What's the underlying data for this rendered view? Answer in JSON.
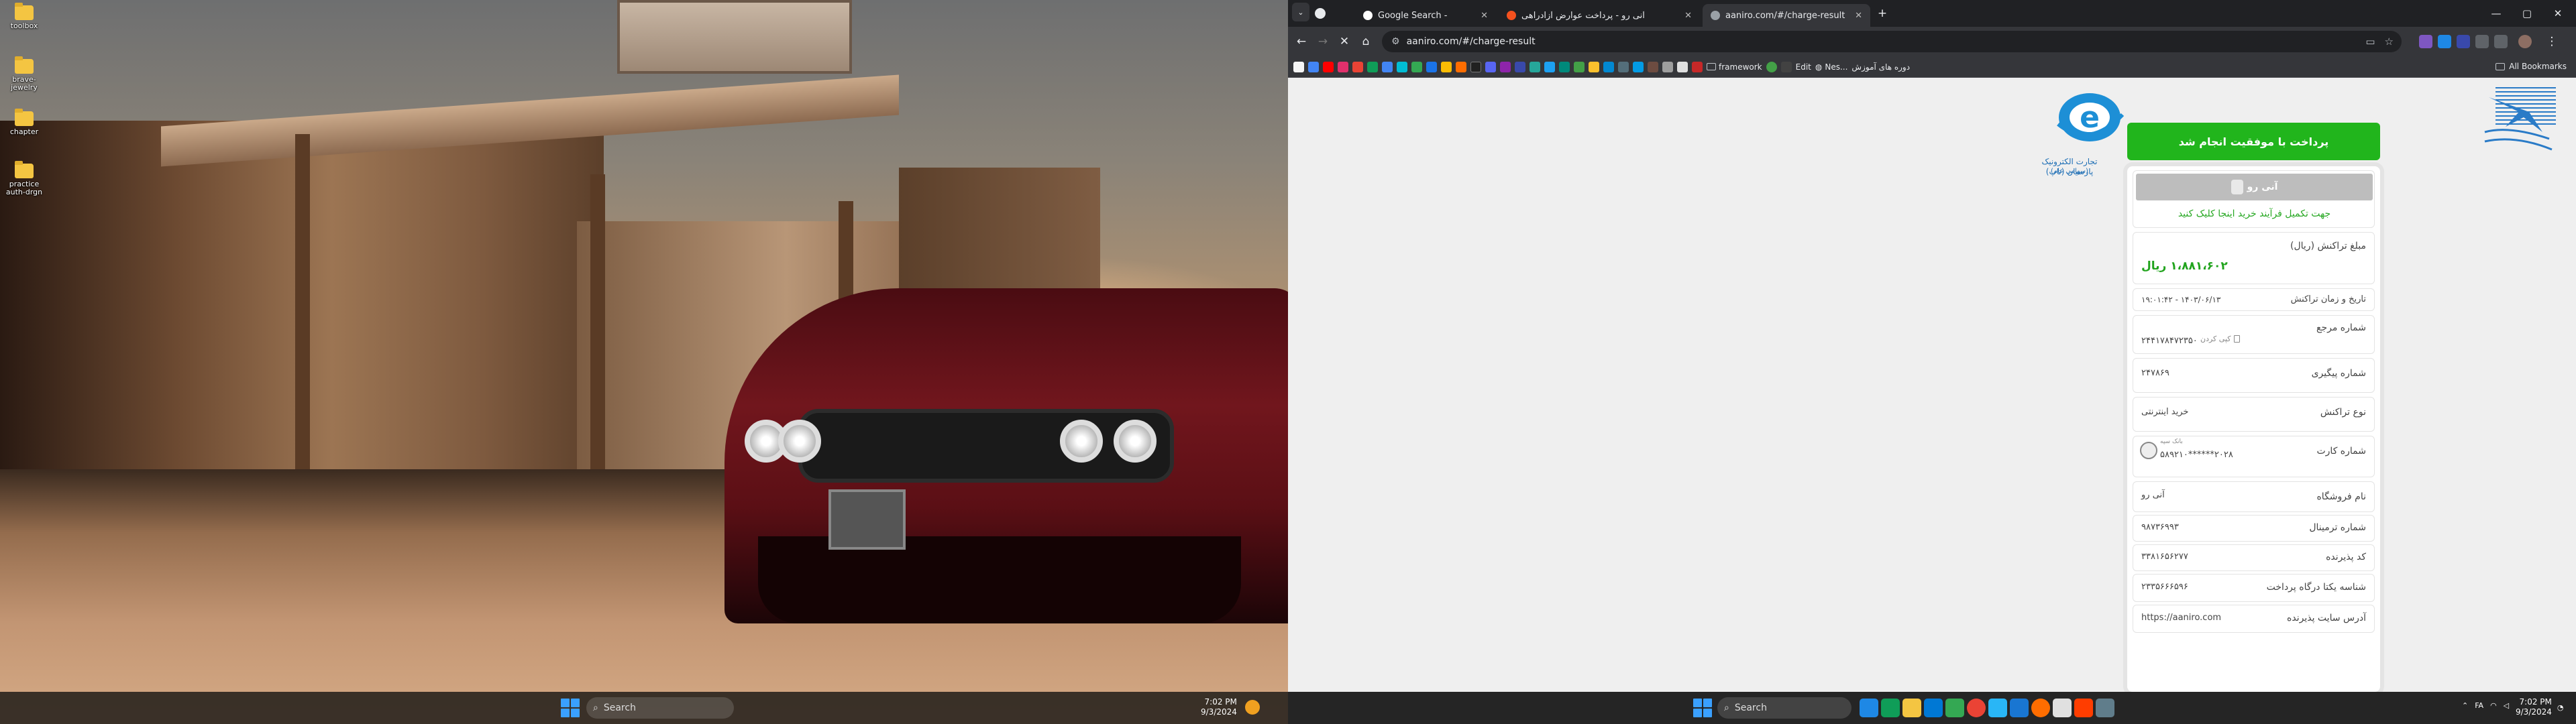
{
  "desktop": {
    "icons": [
      {
        "label": "toolbox"
      },
      {
        "label": "brave-jewelry"
      },
      {
        "label": "chapter"
      },
      {
        "label": "practice auth-drgn"
      }
    ]
  },
  "taskbar_left": {
    "search_label": "Search",
    "time": "7:02 PM",
    "date": "9/3/2024"
  },
  "browser": {
    "tabs": [
      {
        "title": "Google Search - ",
        "favicon_color": "#ffffff"
      },
      {
        "title": "آنی رو - پرداخت عوارض آزادراهی",
        "favicon_color": "#f4511e"
      },
      {
        "title": "aaniro.com/#/charge-result",
        "favicon_color": "#9aa0a6"
      }
    ],
    "url": "aaniro.com/#/charge-result",
    "bookmarks": {
      "framework_label": "framework",
      "edit_label": "Edit",
      "nes_label": "Nes...",
      "course_label": "دوره های آموزش",
      "all_bookmarks_label": "All Bookmarks"
    }
  },
  "page": {
    "left_logo_line1": "تجارت الکترونیک پارسیان (تاپ)",
    "left_logo_line2": "(سهامی عام)",
    "success_banner": "پرداخت با موفقیت انجام شد",
    "gray_bar_text": "آنی رو",
    "complete_link": "جهت تکمیل فرآیند خرید اینجا کلیک کنید",
    "amount_label": "مبلغ تراکنش (ریال)",
    "amount_value": "۱،۸۸۱،۶۰۲ ریال",
    "datetime_label": "تاریخ و زمان تراکنش",
    "datetime_value": "۱۹:۰۱:۴۲ - ۱۴۰۳/۰۶/۱۳",
    "ref_label": "شماره مرجع",
    "ref_value": "۲۴۴۱۷۸۴۷۲۳۵۰",
    "copy_label": "کپی کردن",
    "tracking_label": "شماره پیگیری",
    "tracking_value": "۲۴۷۸۶۹",
    "txn_type_label": "نوع تراکنش",
    "txn_type_value": "خرید اینترنتی",
    "card_label": "شماره کارت",
    "card_bank_small": "بانک سپه",
    "card_value": "۵۸۹۲۱۰******۲۰۲۸",
    "store_label": "نام فروشگاه",
    "store_value": "آنی رو",
    "terminal_label": "شماره ترمینال",
    "terminal_value": "۹۸۷۳۶۹۹۳",
    "acceptor_label": "کد پذیرنده",
    "acceptor_value": "۳۳۸۱۶۵۶۲۷۷",
    "gateway_label": "شناسه یکتا درگاه پرداخت",
    "gateway_value": "۲۳۳۵۶۶۶۵۹۶",
    "site_label": "آدرس سایت پذیرنده",
    "site_value": "https://aaniro.com"
  },
  "taskbar_right": {
    "search_label": "Search",
    "lang": "FA",
    "time": "7:02 PM",
    "date": "9/3/2024"
  },
  "colors": {
    "success_green": "#21b51c",
    "amount_green": "#22a41e",
    "browser_dark": "#35363a"
  }
}
